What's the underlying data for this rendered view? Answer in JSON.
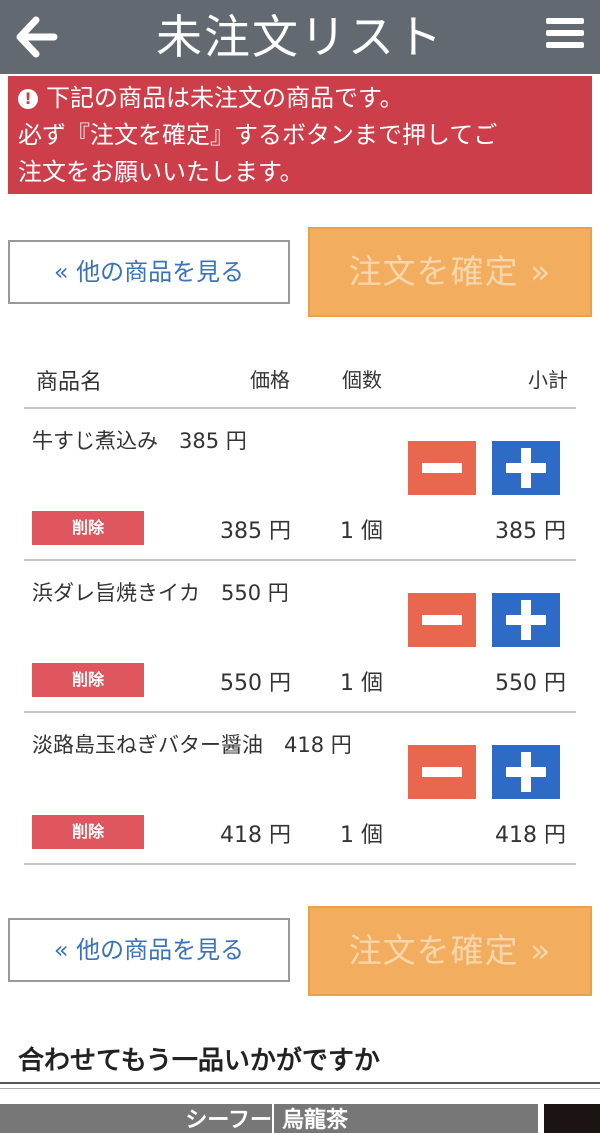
{
  "header": {
    "title": "未注文リスト",
    "back_icon": "arrow-left-icon",
    "menu_icon": "hamburger-menu-icon"
  },
  "alert": {
    "icon": "exclamation-circle-icon",
    "lines": [
      "下記の商品は未注文の商品です。",
      "必ず『注文を確定』するボタンまで押してご",
      "注文をお願いいたします。"
    ]
  },
  "actions": {
    "other_label": "« 他の商品を見る",
    "confirm_label": "注文を確定 »"
  },
  "table": {
    "headers": {
      "name": "商品名",
      "price": "価格",
      "qty": "個数",
      "subtotal": "小計"
    },
    "rows": [
      {
        "name": "牛すじ煮込み　385 円",
        "price": "385 円",
        "qty": "1 個",
        "subtotal": "385 円",
        "delete_label": "削除"
      },
      {
        "name": "浜ダレ旨焼きイカ　550 円",
        "price": "550 円",
        "qty": "1 個",
        "subtotal": "550 円",
        "delete_label": "削除"
      },
      {
        "name": "淡路島玉ねぎバター醤油　418 円",
        "price": "418 円",
        "qty": "1 個",
        "subtotal": "418 円",
        "delete_label": "削除"
      }
    ]
  },
  "suggest": {
    "title": "合わせてもう一品いかがですか",
    "cards": [
      "シーフー",
      "烏龍茶"
    ]
  },
  "colors": {
    "header_bg": "#636970",
    "alert_bg": "#cc3f4a",
    "confirm_bg": "#f2ae5e",
    "minus_bg": "#e8674e",
    "plus_bg": "#2d6bc6",
    "delete_bg": "#e0565e",
    "link": "#3a73b7"
  }
}
